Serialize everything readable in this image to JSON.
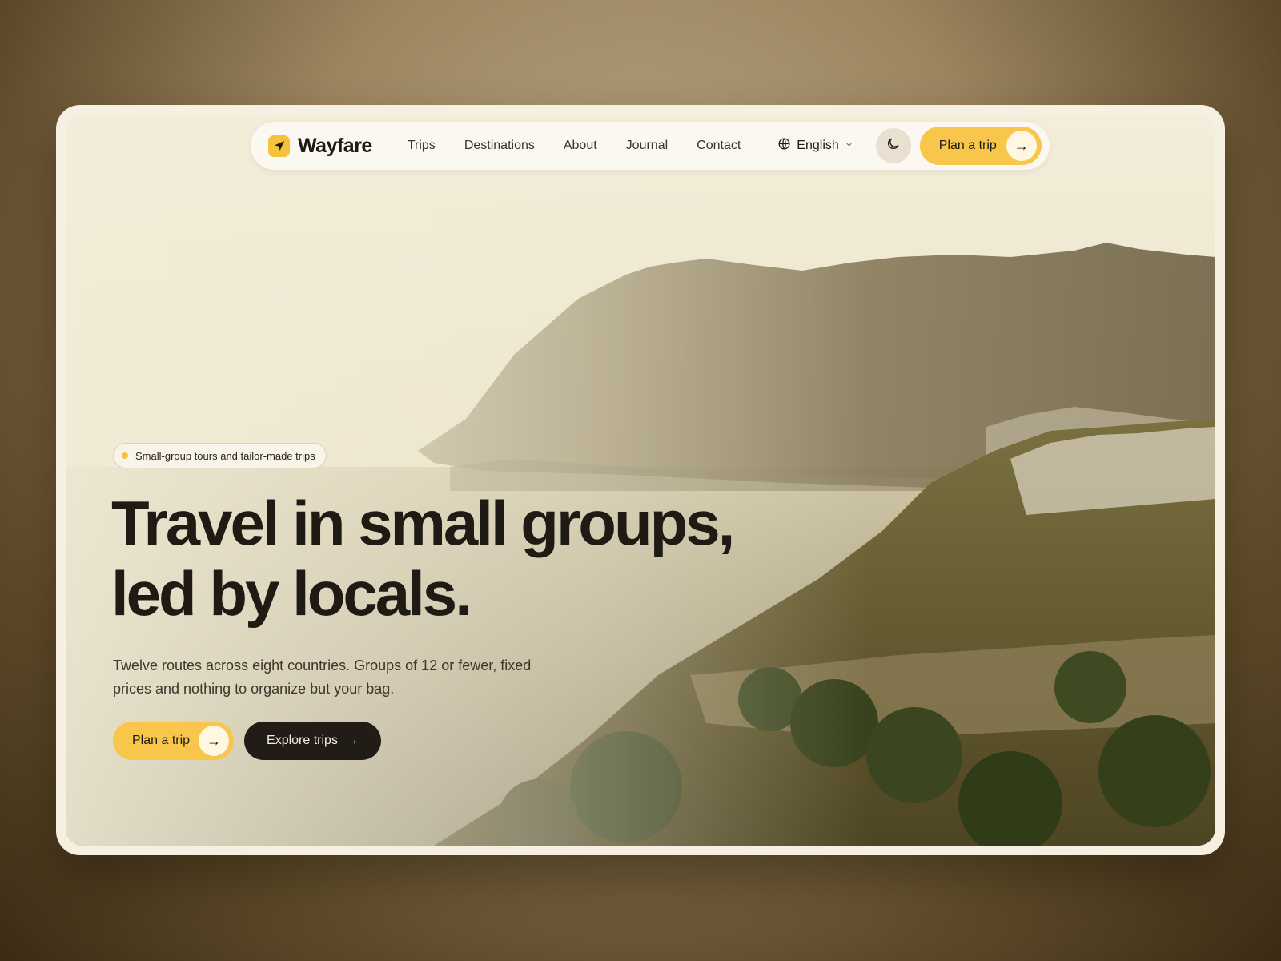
{
  "brand": {
    "name": "Wayfare",
    "logo_icon": "paper-plane-icon",
    "accent": "#f7c64a"
  },
  "nav": {
    "links": [
      "Trips",
      "Destinations",
      "About",
      "Journal",
      "Contact"
    ],
    "language": "English",
    "language_icon": "globe-icon",
    "theme_icon": "moon-icon",
    "cta_label": "Plan a trip",
    "cta_arrow": "→"
  },
  "hero": {
    "badge": "Small-group tours and tailor-made trips",
    "headline_line1": "Travel in small groups,",
    "headline_line2": "led by locals.",
    "subtitle": "Twelve routes across eight countries. Groups of 12 or fewer, fixed prices and nothing to organize but your bag.",
    "primary_cta": "Plan a trip",
    "primary_arrow": "→",
    "secondary_cta": "Explore trips",
    "secondary_arrow": "→"
  },
  "colors": {
    "dark_button": "#221c16",
    "page_bg": "#f6f0e2"
  }
}
